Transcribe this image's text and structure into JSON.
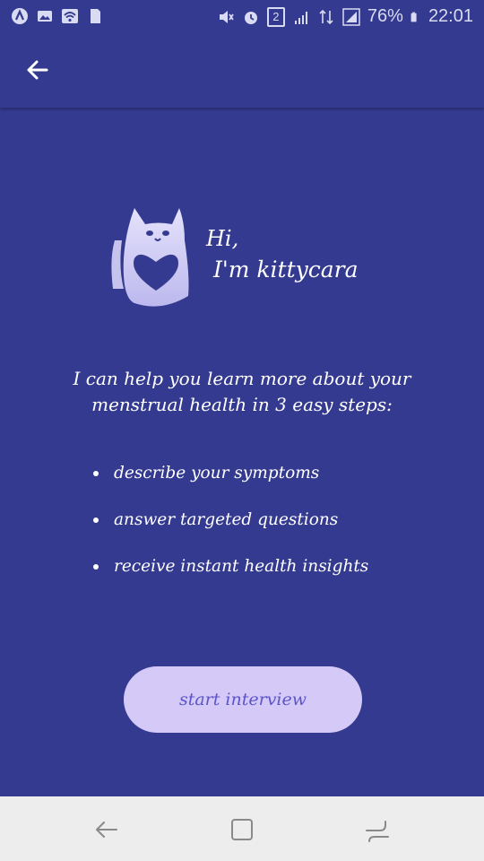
{
  "status_bar": {
    "battery": "76%",
    "time": "22:01",
    "sim_badge": "2",
    "icons": [
      "app-icon",
      "image-icon",
      "wifi-icon",
      "sd-card-icon",
      "mute-icon",
      "alarm-icon",
      "sim-icon",
      "signal-icon",
      "data-icon",
      "signal-full-icon",
      "battery-icon"
    ]
  },
  "header": {
    "back_icon": "arrow-back-icon"
  },
  "greeting": {
    "line1": "Hi,",
    "line2": "I'm kittycara"
  },
  "intro": {
    "line1": "I can help you learn more about your",
    "line2": "menstrual health in 3 easy steps:"
  },
  "steps": [
    {
      "text": "describe your symptoms"
    },
    {
      "text": "answer targeted questions"
    },
    {
      "text": "receive instant health insights"
    }
  ],
  "start_button": {
    "label": "start interview"
  },
  "nav": {
    "back": "nav-back-icon",
    "home": "nav-home-icon",
    "recents": "nav-recents-icon"
  },
  "colors": {
    "background": "#343a8f",
    "button": "#d4c9f7",
    "button_text": "#5b55c9",
    "navbar": "#ededed",
    "mascot": "#dcdaf7"
  }
}
